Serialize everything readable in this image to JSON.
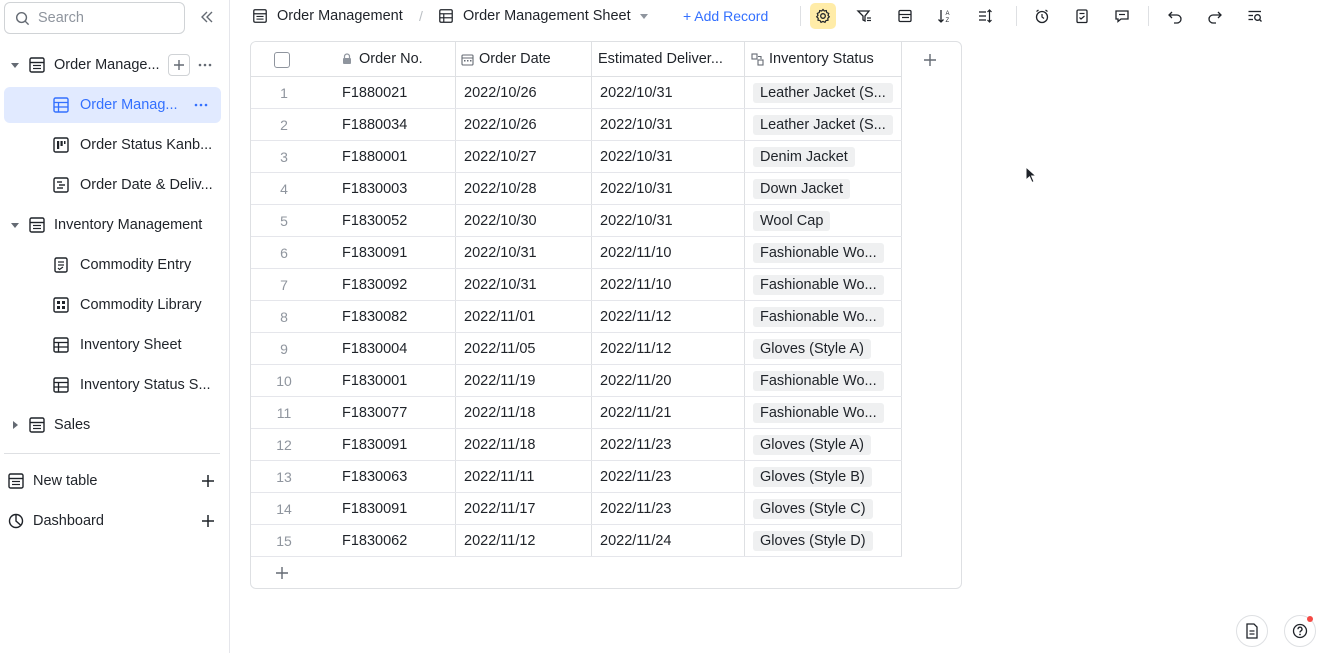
{
  "sidebar": {
    "search_placeholder": "Search",
    "items": [
      {
        "label": "Order Manage...",
        "icon": "table-icon",
        "level": 0
      },
      {
        "label": "Order Manag...",
        "icon": "grid-view-icon",
        "level": 1,
        "active": true
      },
      {
        "label": "Order Status Kanb...",
        "icon": "kanban-icon",
        "level": 1
      },
      {
        "label": "Order Date & Deliv...",
        "icon": "gantt-icon",
        "level": 1
      },
      {
        "label": "Inventory Management",
        "icon": "table-icon",
        "level": 0
      },
      {
        "label": "Commodity Entry",
        "icon": "form-icon",
        "level": 1
      },
      {
        "label": "Commodity Library",
        "icon": "gallery-icon",
        "level": 1
      },
      {
        "label": "Inventory Sheet",
        "icon": "grid-view-icon",
        "level": 1
      },
      {
        "label": "Inventory Status S...",
        "icon": "grid-view-icon",
        "level": 1
      },
      {
        "label": "Sales",
        "icon": "table-icon",
        "level": 0
      }
    ],
    "new_table_label": "New table",
    "dashboard_label": "Dashboard"
  },
  "toolbar": {
    "breadcrumb_table": "Order Management",
    "breadcrumb_sep": "/",
    "view_name": "Order Management Sheet",
    "add_record": "+ Add Record",
    "icons": [
      "settings-icon",
      "filter-icon",
      "group-icon",
      "sort-icon",
      "row-height-icon",
      "reminder-icon",
      "checklist-icon",
      "comment-icon",
      "undo-icon",
      "redo-icon",
      "search-records-icon"
    ]
  },
  "grid": {
    "columns": [
      "Order No.",
      "Order Date",
      "Estimated Deliver...",
      "Inventory Status"
    ],
    "rows": [
      {
        "n": "1",
        "order": "F1880021",
        "date": "2022/10/26",
        "delivery": "2022/10/31",
        "status": "Leather Jacket (S..."
      },
      {
        "n": "2",
        "order": "F1880034",
        "date": "2022/10/26",
        "delivery": "2022/10/31",
        "status": "Leather Jacket (S..."
      },
      {
        "n": "3",
        "order": "F1880001",
        "date": "2022/10/27",
        "delivery": "2022/10/31",
        "status": "Denim Jacket"
      },
      {
        "n": "4",
        "order": "F1830003",
        "date": "2022/10/28",
        "delivery": "2022/10/31",
        "status": "Down Jacket"
      },
      {
        "n": "5",
        "order": "F1830052",
        "date": "2022/10/30",
        "delivery": "2022/10/31",
        "status": "Wool Cap"
      },
      {
        "n": "6",
        "order": "F1830091",
        "date": "2022/10/31",
        "delivery": "2022/11/10",
        "status": "Fashionable Wo..."
      },
      {
        "n": "7",
        "order": "F1830092",
        "date": "2022/10/31",
        "delivery": "2022/11/10",
        "status": "Fashionable Wo..."
      },
      {
        "n": "8",
        "order": "F1830082",
        "date": "2022/11/01",
        "delivery": "2022/11/12",
        "status": "Fashionable Wo..."
      },
      {
        "n": "9",
        "order": "F1830004",
        "date": "2022/11/05",
        "delivery": "2022/11/12",
        "status": "Gloves (Style A)"
      },
      {
        "n": "10",
        "order": "F1830001",
        "date": "2022/11/19",
        "delivery": "2022/11/20",
        "status": "Fashionable Wo..."
      },
      {
        "n": "11",
        "order": "F1830077",
        "date": "2022/11/18",
        "delivery": "2022/11/21",
        "status": "Fashionable Wo..."
      },
      {
        "n": "12",
        "order": "F1830091",
        "date": "2022/11/18",
        "delivery": "2022/11/23",
        "status": "Gloves (Style A)"
      },
      {
        "n": "13",
        "order": "F1830063",
        "date": "2022/11/11",
        "delivery": "2022/11/23",
        "status": "Gloves (Style B)"
      },
      {
        "n": "14",
        "order": "F1830091",
        "date": "2022/11/17",
        "delivery": "2022/11/23",
        "status": "Gloves (Style C)"
      },
      {
        "n": "15",
        "order": "F1830062",
        "date": "2022/11/12",
        "delivery": "2022/11/24",
        "status": "Gloves (Style D)"
      }
    ]
  },
  "colors": {
    "accent": "#3370ff",
    "active_bg": "#e1eaff",
    "settings_highlight": "#ffeca8",
    "tag_bg": "#eff0f1"
  }
}
